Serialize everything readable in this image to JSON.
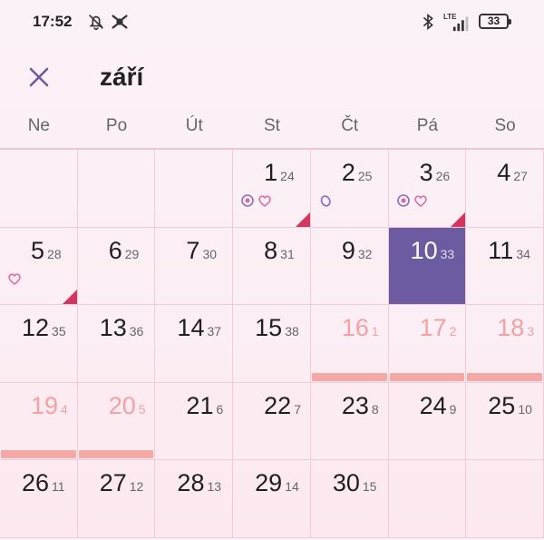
{
  "status": {
    "time": "17:52",
    "network": "LTE",
    "battery": "33"
  },
  "header": {
    "title": "září"
  },
  "weekdays": [
    "Ne",
    "Po",
    "Út",
    "St",
    "Čt",
    "Pá",
    "So"
  ],
  "colors": {
    "today": "#6c5ba0",
    "period_bar": "#f5a9a6",
    "predicted_text": "#f2a1a4",
    "marker": "#d3365f",
    "symbol_pink": "#e0679a",
    "symbol_purple": "#8e6cc9"
  },
  "calendar": {
    "leading_empty": 3,
    "days": [
      {
        "day": "1",
        "cycle": "24",
        "icons": [
          "ovulation-icon",
          "heart-icon"
        ],
        "triangle": true
      },
      {
        "day": "2",
        "cycle": "25",
        "icons": [
          "oval-icon"
        ]
      },
      {
        "day": "3",
        "cycle": "26",
        "icons": [
          "ovulation-icon",
          "heart-icon"
        ],
        "triangle": true
      },
      {
        "day": "4",
        "cycle": "27"
      },
      {
        "day": "5",
        "cycle": "28",
        "icons": [
          "heart-icon"
        ],
        "triangle": true
      },
      {
        "day": "6",
        "cycle": "29"
      },
      {
        "day": "7",
        "cycle": "30"
      },
      {
        "day": "8",
        "cycle": "31"
      },
      {
        "day": "9",
        "cycle": "32"
      },
      {
        "day": "10",
        "cycle": "33",
        "today": true
      },
      {
        "day": "11",
        "cycle": "34"
      },
      {
        "day": "12",
        "cycle": "35"
      },
      {
        "day": "13",
        "cycle": "36"
      },
      {
        "day": "14",
        "cycle": "37"
      },
      {
        "day": "15",
        "cycle": "38"
      },
      {
        "day": "16",
        "cycle": "1",
        "period": true
      },
      {
        "day": "17",
        "cycle": "2",
        "period": true
      },
      {
        "day": "18",
        "cycle": "3",
        "period": true
      },
      {
        "day": "19",
        "cycle": "4",
        "period": true
      },
      {
        "day": "20",
        "cycle": "5",
        "period": true
      },
      {
        "day": "21",
        "cycle": "6"
      },
      {
        "day": "22",
        "cycle": "7"
      },
      {
        "day": "23",
        "cycle": "8"
      },
      {
        "day": "24",
        "cycle": "9"
      },
      {
        "day": "25",
        "cycle": "10"
      },
      {
        "day": "26",
        "cycle": "11"
      },
      {
        "day": "27",
        "cycle": "12"
      },
      {
        "day": "28",
        "cycle": "13"
      },
      {
        "day": "29",
        "cycle": "14"
      },
      {
        "day": "30",
        "cycle": "15"
      }
    ]
  }
}
